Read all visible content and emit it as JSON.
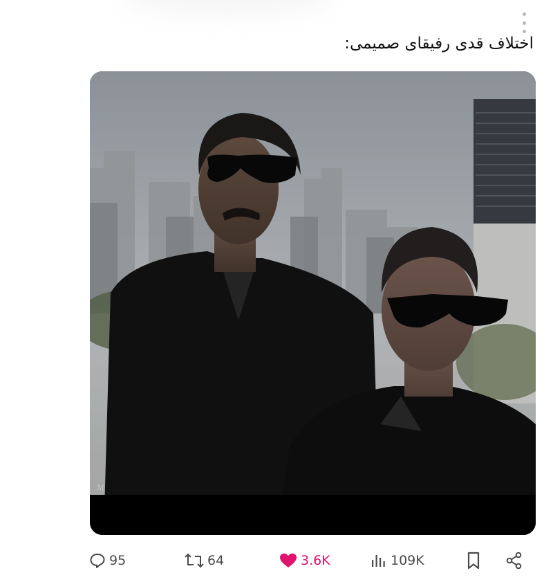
{
  "post": {
    "text": "اختلاف قدی رفیقای صمیمی:"
  },
  "actions": {
    "replies": "95",
    "reposts": "64",
    "likes": "3.6K",
    "views": "109K"
  },
  "icons": {
    "more": "more-vertical-icon",
    "reply": "comment-bubble-icon",
    "repost": "repost-arrows-icon",
    "like": "heart-filled-icon",
    "views": "bar-chart-icon",
    "bookmark": "bookmark-icon",
    "share": "share-icon"
  },
  "colors": {
    "like_active": "#e0136e",
    "action_gray": "#4a4a4a",
    "muted_dots": "#b8b8b8"
  }
}
